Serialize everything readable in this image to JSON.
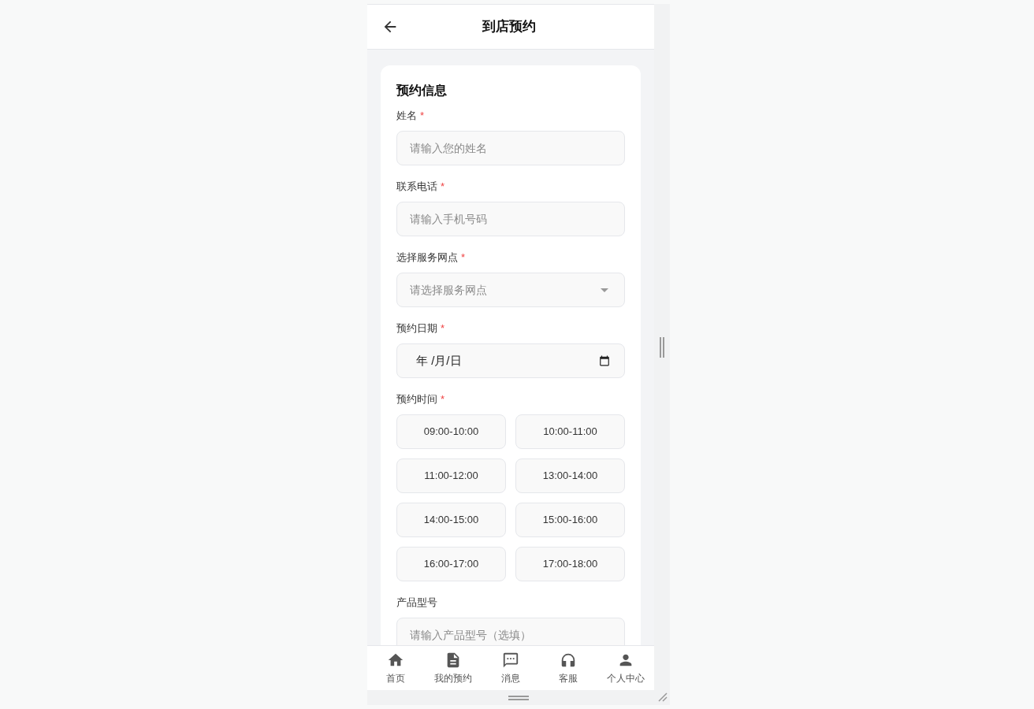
{
  "header": {
    "title": "到店预约"
  },
  "form": {
    "title": "预约信息",
    "fields": [
      {
        "kind": "text",
        "label": "姓名",
        "required_mark": "*",
        "placeholder": "请输入您的姓名"
      },
      {
        "kind": "text",
        "label": "联系电话",
        "required_mark": "*",
        "placeholder": "请输入手机号码"
      },
      {
        "kind": "select",
        "label": "选择服务网点",
        "required_mark": "*",
        "placeholder": "请选择服务网点"
      },
      {
        "kind": "date",
        "label": "预约日期",
        "required_mark": "*",
        "value": "年 /月/日"
      },
      {
        "kind": "slots",
        "label": "预约时间",
        "required_mark": "*",
        "slots": [
          {
            "label": "09:00-10:00",
            "selected": false
          },
          {
            "label": "10:00-11:00",
            "selected": false
          },
          {
            "label": "11:00-12:00",
            "selected": false
          },
          {
            "label": "13:00-14:00",
            "selected": false
          },
          {
            "label": "14:00-15:00",
            "selected": false
          },
          {
            "label": "15:00-16:00",
            "selected": false
          },
          {
            "label": "16:00-17:00",
            "selected": false
          },
          {
            "label": "17:00-18:00",
            "selected": false
          }
        ]
      },
      {
        "kind": "text",
        "label": "产品型号",
        "placeholder": "请输入产品型号（选填）"
      }
    ]
  },
  "bottom_nav": [
    {
      "kind": "home",
      "label": "首页"
    },
    {
      "kind": "document",
      "label": "我的预约"
    },
    {
      "kind": "chat",
      "label": "消息"
    },
    {
      "kind": "headset",
      "label": "客服"
    },
    {
      "kind": "person",
      "label": "个人中心"
    }
  ]
}
